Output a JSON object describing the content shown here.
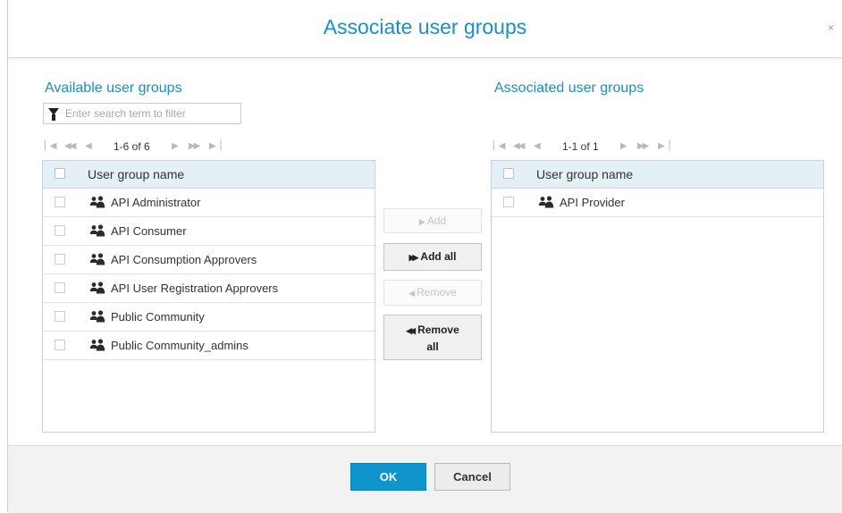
{
  "dialog": {
    "title": "Associate user groups",
    "close_glyph": "×"
  },
  "available": {
    "title": "Available user groups",
    "search_placeholder": "Enter search term to filter",
    "pager_info": "1-6 of 6",
    "column_header": "User group name",
    "rows": [
      {
        "label": "API Administrator"
      },
      {
        "label": "API Consumer"
      },
      {
        "label": "API Consumption Approvers"
      },
      {
        "label": "API User Registration Approvers"
      },
      {
        "label": "Public Community"
      },
      {
        "label": "Public Community_admins"
      }
    ]
  },
  "associated": {
    "title": "Associated user groups",
    "pager_info": "1-1 of 1",
    "column_header": "User group name",
    "rows": [
      {
        "label": "API Provider"
      }
    ]
  },
  "transfer": {
    "add_label": "Add",
    "add_icon": "▶",
    "add_all_label": "Add all",
    "add_all_icon": "▶▶",
    "remove_label": "Remove",
    "remove_icon": "◀",
    "remove_all_label_line1": "Remove",
    "remove_all_label_line2": "all",
    "remove_all_icon": "◀◀"
  },
  "footer": {
    "ok_label": "OK",
    "cancel_label": "Cancel"
  },
  "colors": {
    "accent": "#1b8ec4",
    "primary_button": "#0f95cc",
    "grid_header_bg": "#e3f0f6"
  }
}
